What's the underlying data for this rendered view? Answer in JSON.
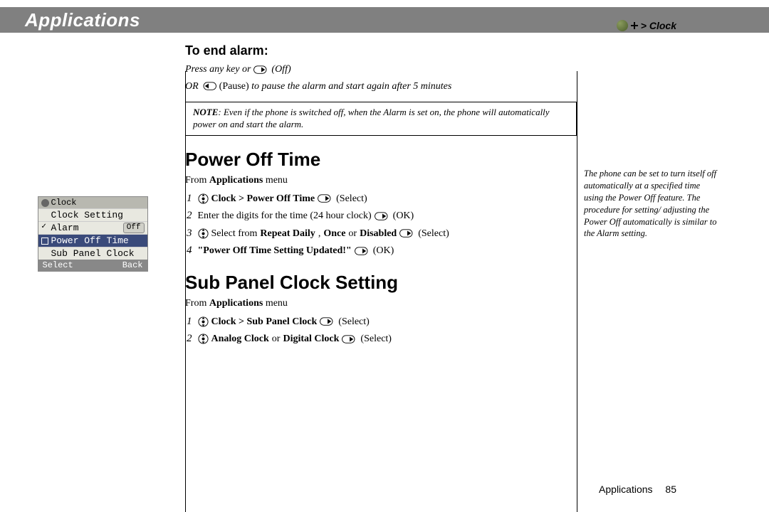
{
  "header": {
    "title": "Applications",
    "breadcrumb_prefix": "> ",
    "breadcrumb": "Clock"
  },
  "phone_menu": {
    "title": "Clock",
    "items": [
      "Clock Setting",
      "Alarm",
      "Power Off Time",
      "Sub Panel Clock"
    ],
    "alarm_status": "Off",
    "softkeys": {
      "left": "Select",
      "right": "Back"
    }
  },
  "sections": {
    "end_alarm": {
      "heading": "To end alarm:",
      "line1_a": "Press any key or ",
      "line1_b": " (Off)",
      "line2_a": "OR ",
      "line2_b": " (Pause)",
      "line2_c": " to pause the alarm and start again after 5 minutes",
      "note_lead": "NOTE",
      "note_body": ": Even if the phone is switched off, when the Alarm is set on, the phone will automatically power on and start the alarm."
    },
    "power_off": {
      "heading": "Power Off Time",
      "from_a": "From ",
      "from_b": "Applications",
      "from_c": " menu",
      "step1_b": "Clock > Power Off Time",
      "step1_c": " (Select)",
      "step2_a": "Enter the digits for the time (24 hour clock) ",
      "step2_b": " (OK)",
      "step3_a": " Select from ",
      "step3_b": "Repeat Daily",
      "step3_c": ", ",
      "step3_d": "Once",
      "step3_e": " or ",
      "step3_f": "Disabled",
      "step3_g": " (Select)",
      "step4_a": "\"Power Off Time Setting Updated!\"",
      "step4_b": " (OK)"
    },
    "sub_panel": {
      "heading": "Sub Panel Clock Setting",
      "from_a": "From ",
      "from_b": "Applications",
      "from_c": " menu",
      "step1_b": "Clock > Sub Panel Clock",
      "step1_c": " (Select)",
      "step2_b1": "Analog Clock",
      "step2_b2": " or ",
      "step2_b3": "Digital Clock",
      "step2_c": " (Select)"
    }
  },
  "side_note": "The phone can be set to turn itself off automatically at a specified time using the Power Off feature. The procedure for setting/ adjusting the Power Off automatically is similar to the Alarm setting.",
  "footer": {
    "section": "Applications",
    "page": "85"
  }
}
